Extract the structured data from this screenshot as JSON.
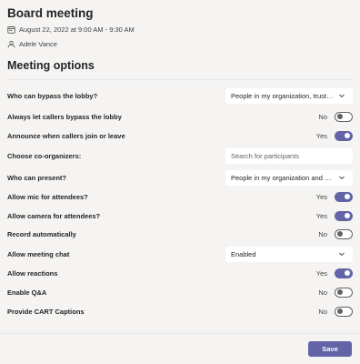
{
  "meeting": {
    "title": "Board meeting",
    "datetime": "August 22, 2022 at 9:00 AM - 9:30 AM",
    "organizer": "Adele Vance"
  },
  "options_title": "Meeting options",
  "options": {
    "bypass_lobby": {
      "label": "Who can bypass the lobby?",
      "value": "People in my organization, truste…"
    },
    "callers_bypass": {
      "label": "Always let callers bypass the lobby",
      "state": "No"
    },
    "announce": {
      "label": "Announce when callers join or leave",
      "state": "Yes"
    },
    "coorganizers": {
      "label": "Choose co-organizers:",
      "placeholder": "Search for participants"
    },
    "who_present": {
      "label": "Who can present?",
      "value": "People in my organization and gu…"
    },
    "mic": {
      "label": "Allow mic for attendees?",
      "state": "Yes"
    },
    "camera": {
      "label": "Allow camera for attendees?",
      "state": "Yes"
    },
    "record": {
      "label": "Record automatically",
      "state": "No"
    },
    "chat": {
      "label": "Allow meeting chat",
      "value": "Enabled"
    },
    "reactions": {
      "label": "Allow reactions",
      "state": "Yes"
    },
    "qa": {
      "label": "Enable Q&A",
      "state": "No"
    },
    "cart": {
      "label": "Provide CART Captions",
      "state": "No"
    }
  },
  "save_label": "Save",
  "colors": {
    "accent": "#6264a7",
    "background": "#f5f4f3"
  },
  "icons": {
    "date": "calendar-icon",
    "organizer": "person-icon",
    "dropdown": "chevron-down-icon"
  }
}
